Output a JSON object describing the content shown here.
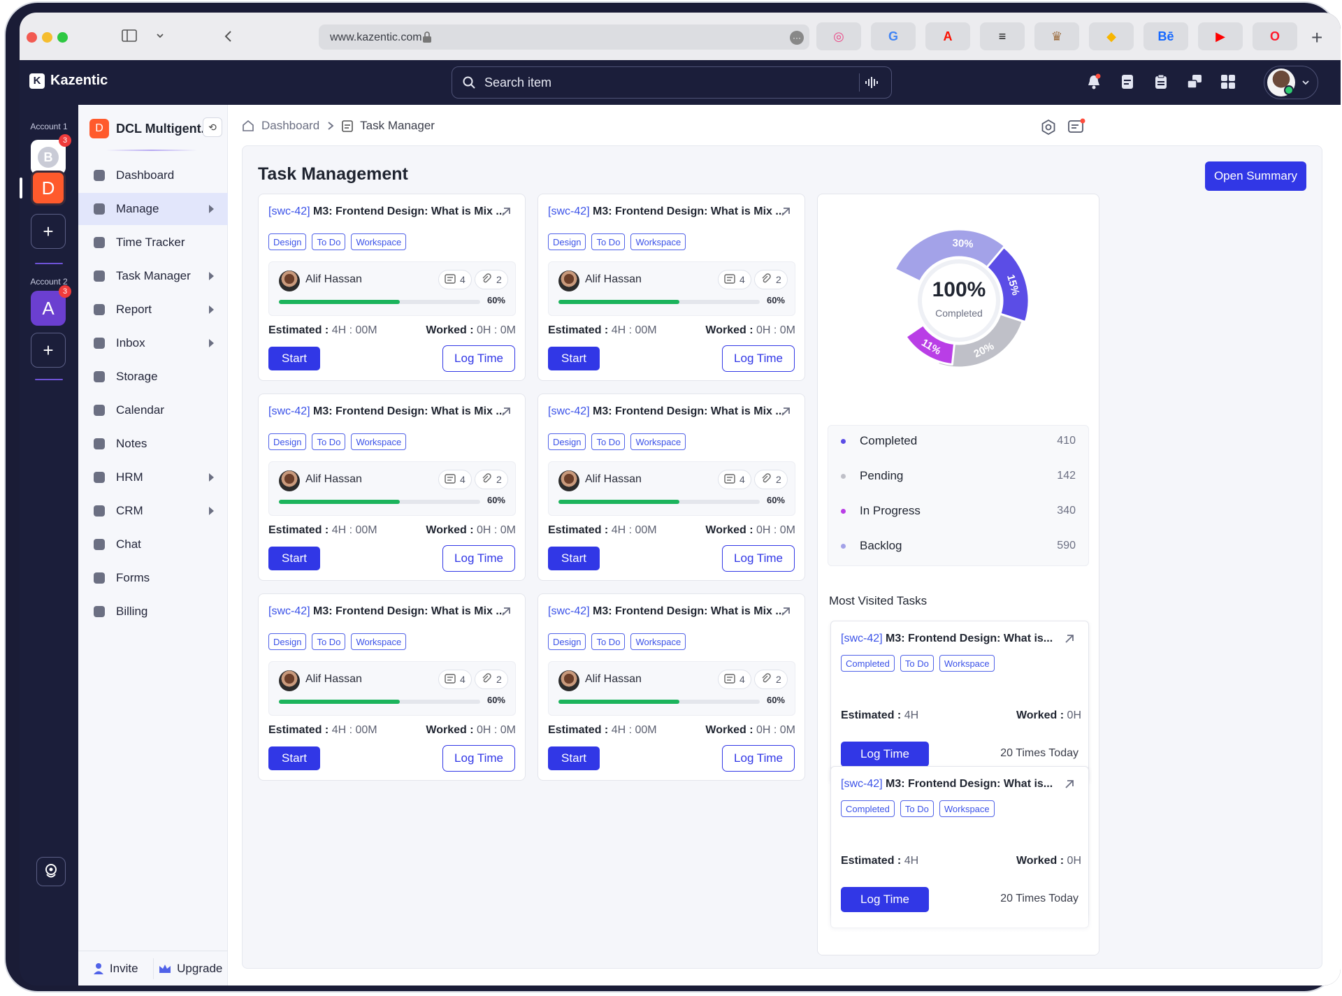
{
  "browser": {
    "url": "www.kazentic.com",
    "extensions": [
      "dribbble-icon",
      "google-icon",
      "adobe-icon",
      "adidas-icon",
      "crown-icon",
      "sketch-icon",
      "behance-icon",
      "youtube-icon",
      "opera-icon"
    ],
    "behance_label": "Bē"
  },
  "app": {
    "brand": "Kazentic",
    "search_placeholder": "Search item"
  },
  "rail": {
    "account1_label": "Account 1",
    "account1_badge": "3",
    "account1_tile_letter": "D",
    "account2_label": "Account 2",
    "account2_letter": "A",
    "account2_badge": "3",
    "add": "+"
  },
  "sidebar": {
    "workspace_letter": "D",
    "workspace_name": "DCL Multigent...",
    "items": [
      {
        "label": "Dashboard",
        "icon": "dashboard-icon",
        "caret": false
      },
      {
        "label": "Manage",
        "icon": "manage-icon",
        "caret": true,
        "active": true
      },
      {
        "label": "Time Tracker",
        "icon": "clock-icon",
        "caret": false
      },
      {
        "label": "Task Manager",
        "icon": "clipboard-icon",
        "caret": true
      },
      {
        "label": "Report",
        "icon": "report-icon",
        "caret": true
      },
      {
        "label": "Inbox",
        "icon": "inbox-icon",
        "caret": true
      },
      {
        "label": "Storage",
        "icon": "cloud-icon",
        "caret": false
      },
      {
        "label": "Calendar",
        "icon": "calendar-icon",
        "caret": false
      },
      {
        "label": "Notes",
        "icon": "notes-icon",
        "caret": false
      },
      {
        "label": "HRM",
        "icon": "hrm-icon",
        "caret": true
      },
      {
        "label": "CRM",
        "icon": "crm-icon",
        "caret": true
      },
      {
        "label": "Chat",
        "icon": "chat-icon",
        "caret": false
      },
      {
        "label": "Forms",
        "icon": "forms-icon",
        "caret": false
      },
      {
        "label": "Billing",
        "icon": "billing-icon",
        "caret": false
      }
    ],
    "invite": "Invite",
    "upgrade": "Upgrade"
  },
  "breadcrumb": {
    "home": "Dashboard",
    "current": "Task Manager"
  },
  "main": {
    "title": "Task Management",
    "open_summary": "Open Summary",
    "task_cards": [
      {
        "code": "[swc-42]",
        "title": "M3: Frontend Design: What is Mix ...",
        "tags": [
          "Design",
          "To Do",
          "Workspace"
        ],
        "assignee": "Alif Hassan",
        "notes": "4",
        "attachments": "2",
        "progress": 60,
        "progress_label": "60%",
        "estimated_label": "Estimated :",
        "estimated": "4H : 00M",
        "worked_label": "Worked :",
        "worked": "0H : 0M",
        "start": "Start",
        "log_time": "Log Time"
      },
      {
        "code": "[swc-42]",
        "title": "M3: Frontend Design: What is Mix ...",
        "tags": [
          "Design",
          "To Do",
          "Workspace"
        ],
        "assignee": "Alif Hassan",
        "notes": "4",
        "attachments": "2",
        "progress": 60,
        "progress_label": "60%",
        "estimated_label": "Estimated :",
        "estimated": "4H : 00M",
        "worked_label": "Worked :",
        "worked": "0H : 0M",
        "start": "Start",
        "log_time": "Log Time"
      },
      {
        "code": "[swc-42]",
        "title": "M3: Frontend Design: What is Mix ...",
        "tags": [
          "Design",
          "To Do",
          "Workspace"
        ],
        "assignee": "Alif Hassan",
        "notes": "4",
        "attachments": "2",
        "progress": 60,
        "progress_label": "60%",
        "estimated_label": "Estimated :",
        "estimated": "4H : 00M",
        "worked_label": "Worked :",
        "worked": "0H : 0M",
        "start": "Start",
        "log_time": "Log Time"
      },
      {
        "code": "[swc-42]",
        "title": "M3: Frontend Design: What is Mix ...",
        "tags": [
          "Design",
          "To Do",
          "Workspace"
        ],
        "assignee": "Alif Hassan",
        "notes": "4",
        "attachments": "2",
        "progress": 60,
        "progress_label": "60%",
        "estimated_label": "Estimated :",
        "estimated": "4H : 00M",
        "worked_label": "Worked :",
        "worked": "0H : 0M",
        "start": "Start",
        "log_time": "Log Time"
      },
      {
        "code": "[swc-42]",
        "title": "M3: Frontend Design: What is Mix ...",
        "tags": [
          "Design",
          "To Do",
          "Workspace"
        ],
        "assignee": "Alif Hassan",
        "notes": "4",
        "attachments": "2",
        "progress": 60,
        "progress_label": "60%",
        "estimated_label": "Estimated :",
        "estimated": "4H : 00M",
        "worked_label": "Worked :",
        "worked": "0H : 0M",
        "start": "Start",
        "log_time": "Log Time"
      },
      {
        "code": "[swc-42]",
        "title": "M3: Frontend Design: What is Mix ...",
        "tags": [
          "Design",
          "To Do",
          "Workspace"
        ],
        "assignee": "Alif Hassan",
        "notes": "4",
        "attachments": "2",
        "progress": 60,
        "progress_label": "60%",
        "estimated_label": "Estimated :",
        "estimated": "4H : 00M",
        "worked_label": "Worked :",
        "worked": "0H : 0M",
        "start": "Start",
        "log_time": "Log Time"
      }
    ]
  },
  "summary": {
    "center_value": "100%",
    "center_label": "Completed",
    "segments": [
      {
        "label": "30%",
        "value": 30,
        "color": "#a3a2e8"
      },
      {
        "label": "15%",
        "value": 15,
        "color": "#5b4de6"
      },
      {
        "label": "20%",
        "value": 20,
        "color": "#bfc0c8"
      },
      {
        "label": "11%",
        "value": 11,
        "color": "#b93ee6"
      }
    ],
    "legend": [
      {
        "label": "Completed",
        "value": "410",
        "color": "#5b4de6"
      },
      {
        "label": "Pending",
        "value": "142",
        "color": "#bfc0c8"
      },
      {
        "label": "In Progress",
        "value": "340",
        "color": "#b93ee6"
      },
      {
        "label": "Backlog",
        "value": "590",
        "color": "#a3a2e8"
      }
    ],
    "most_visited_title": "Most Visited Tasks",
    "most_visited": [
      {
        "code": "[swc-42]",
        "title": "M3: Frontend Design: What is...",
        "tags": [
          "Completed",
          "To Do",
          "Workspace"
        ],
        "estimated_label": "Estimated :",
        "estimated": "4H",
        "worked_label": "Worked :",
        "worked": "0H",
        "log_time": "Log Time",
        "times": "20 Times Today"
      },
      {
        "code": "[swc-42]",
        "title": "M3: Frontend Design: What is...",
        "tags": [
          "Completed",
          "To Do",
          "Workspace"
        ],
        "estimated_label": "Estimated :",
        "estimated": "4H",
        "worked_label": "Worked :",
        "worked": "0H",
        "log_time": "Log Time",
        "times": "20 Times Today"
      }
    ]
  },
  "colors": {
    "primary": "#3137e6",
    "progress": "#1cb45c",
    "brand_dark": "#1b1e3a",
    "workspace": "#ff5a2c",
    "account2": "#6b3fd0"
  }
}
